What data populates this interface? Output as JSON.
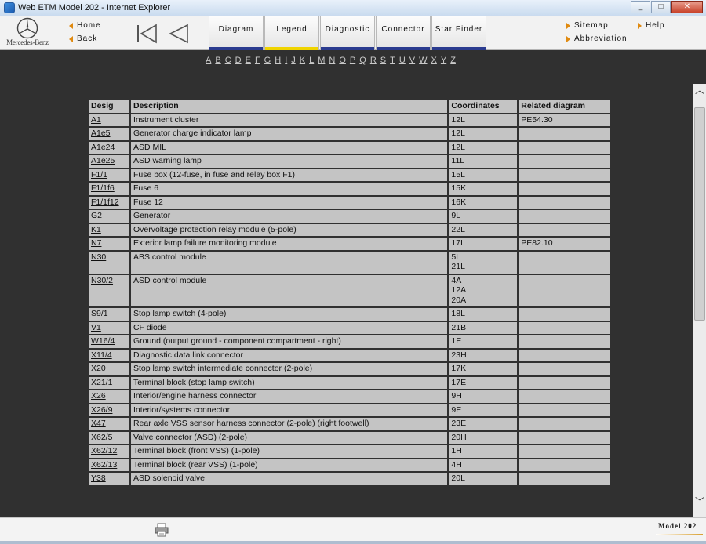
{
  "window": {
    "title": "Web ETM Model 202 - Internet Explorer",
    "minimize": "_",
    "maximize": "□",
    "close": "✕"
  },
  "header": {
    "brand": "Mercedes-Benz",
    "home": "Home",
    "back": "Back",
    "tabs": [
      "Diagram",
      "Legend",
      "Diagnostic",
      "Connector",
      "Star Finder"
    ],
    "active_tab": "Legend",
    "sitemap": "Sitemap",
    "help": "Help",
    "abbreviation": "Abbreviation"
  },
  "alphabet": [
    "A",
    "B",
    "C",
    "D",
    "E",
    "F",
    "G",
    "H",
    "I",
    "J",
    "K",
    "L",
    "M",
    "N",
    "O",
    "P",
    "Q",
    "R",
    "S",
    "T",
    "U",
    "V",
    "W",
    "X",
    "Y",
    "Z"
  ],
  "table": {
    "headers": [
      "Desig",
      "Description",
      "Coordinates",
      "Related diagram"
    ],
    "rows": [
      {
        "desig": "A1",
        "description": "Instrument cluster",
        "coords": "12L",
        "related": "PE54.30"
      },
      {
        "desig": "A1e5",
        "description": "Generator charge indicator lamp",
        "coords": "12L",
        "related": ""
      },
      {
        "desig": "A1e24",
        "description": "ASD MIL",
        "coords": "12L",
        "related": ""
      },
      {
        "desig": "A1e25",
        "description": "ASD warning lamp",
        "coords": "11L",
        "related": ""
      },
      {
        "desig": "F1/1",
        "description": "Fuse box (12-fuse, in fuse and relay box F1)",
        "coords": "15L",
        "related": ""
      },
      {
        "desig": "F1/1f6",
        "description": "Fuse 6",
        "coords": "15K",
        "related": ""
      },
      {
        "desig": "F1/1f12",
        "description": "Fuse 12",
        "coords": "16K",
        "related": ""
      },
      {
        "desig": "G2",
        "description": "Generator",
        "coords": "9L",
        "related": ""
      },
      {
        "desig": "K1",
        "description": "Overvoltage protection relay module (5-pole)",
        "coords": "22L",
        "related": ""
      },
      {
        "desig": "N7",
        "description": "Exterior lamp failure monitoring module",
        "coords": "17L",
        "related": "PE82.10"
      },
      {
        "desig": "N30",
        "description": "ABS control module",
        "coords": "5L\n21L",
        "related": ""
      },
      {
        "desig": "N30/2",
        "description": "ASD control module",
        "coords": "4A\n12A\n20A",
        "related": ""
      },
      {
        "desig": "S9/1",
        "description": "Stop lamp switch (4-pole)",
        "coords": "18L",
        "related": ""
      },
      {
        "desig": "V1",
        "description": "CF diode",
        "coords": "21B",
        "related": ""
      },
      {
        "desig": "W16/4",
        "description": "Ground (output ground - component compartment - right)",
        "coords": "1E",
        "related": ""
      },
      {
        "desig": "X11/4",
        "description": "Diagnostic data link connector",
        "coords": "23H",
        "related": ""
      },
      {
        "desig": "X20",
        "description": "Stop lamp switch intermediate connector (2-pole)",
        "coords": "17K",
        "related": ""
      },
      {
        "desig": "X21/1",
        "description": "Terminal block (stop lamp switch)",
        "coords": "17E",
        "related": ""
      },
      {
        "desig": "X26",
        "description": "Interior/engine harness connector",
        "coords": "9H",
        "related": ""
      },
      {
        "desig": "X26/9",
        "description": "Interior/systems connector",
        "coords": "9E",
        "related": ""
      },
      {
        "desig": "X47",
        "description": "Rear axle VSS sensor harness connector (2-pole) (right footwell)",
        "coords": "23E",
        "related": ""
      },
      {
        "desig": "X62/5",
        "description": "Valve connector (ASD) (2-pole)",
        "coords": "20H",
        "related": ""
      },
      {
        "desig": "X62/12",
        "description": "Terminal block (front VSS) (1-pole)",
        "coords": "1H",
        "related": ""
      },
      {
        "desig": "X62/13",
        "description": "Terminal block (rear VSS) (1-pole)",
        "coords": "4H",
        "related": ""
      },
      {
        "desig": "Y38",
        "description": "ASD solenoid valve",
        "coords": "20L",
        "related": ""
      }
    ]
  },
  "footer": {
    "model": "Model 202"
  }
}
